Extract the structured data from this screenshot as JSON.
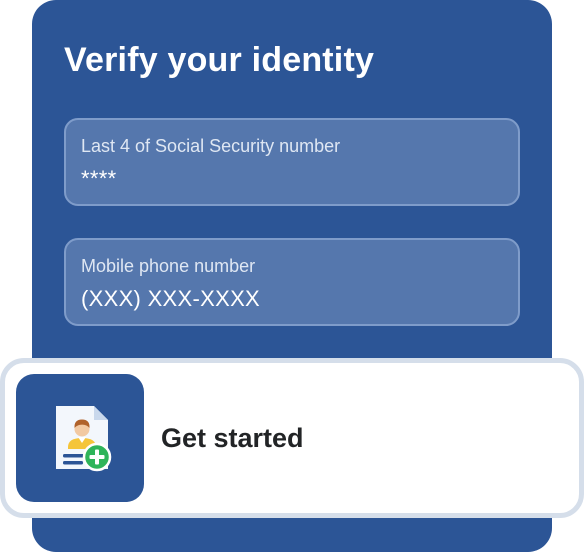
{
  "form": {
    "title": "Verify your identity",
    "fields": [
      {
        "label": "Last 4 of Social Security number",
        "value": "****"
      },
      {
        "label": "Mobile phone number",
        "value": "(XXX) XXX-XXXX"
      }
    ]
  },
  "cta": {
    "label": "Get started",
    "icon": "id-card-add-icon"
  },
  "colors": {
    "panel": "#2c5596",
    "field_bg": "#5577ad",
    "field_border": "#7f9cca",
    "card_border": "#d5deea",
    "add_badge": "#2fb45a"
  }
}
